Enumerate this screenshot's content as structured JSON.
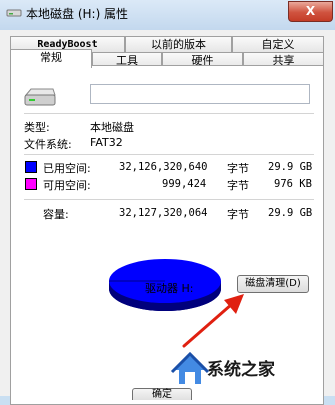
{
  "window": {
    "title": "本地磁盘 (H:) 属性",
    "close_label": "X"
  },
  "tabs": {
    "row1": [
      "ReadyBoost",
      "以前的版本",
      "自定义"
    ],
    "row2": [
      "常规",
      "工具",
      "硬件",
      "共享"
    ],
    "active": "常规"
  },
  "general": {
    "name_value": "",
    "type_label": "类型:",
    "type_value": "本地磁盘",
    "fs_label": "文件系统:",
    "fs_value": "FAT32",
    "used_label": "已用空间:",
    "used_bytes": "32,126,320,640",
    "used_unit": "字节",
    "used_size": "29.9 GB",
    "free_label": "可用空间:",
    "free_bytes": "999,424",
    "free_unit": "字节",
    "free_size": "976 KB",
    "capacity_label": "容量:",
    "capacity_bytes": "32,127,320,064",
    "capacity_unit": "字节",
    "capacity_size": "29.9 GB",
    "drive_label": "驱动器 H:",
    "cleanup_button": "磁盘清理(D)",
    "used_color": "#0000ff",
    "free_color": "#ff00ff",
    "used_fraction": 0.99997
  },
  "footer": {
    "partial_button": "确定"
  },
  "watermark": {
    "text": "系统之家",
    "logo_icon": "house-logo-icon"
  },
  "colors": {
    "titlebar": "#c9dff2",
    "arrow": "#e02010"
  }
}
